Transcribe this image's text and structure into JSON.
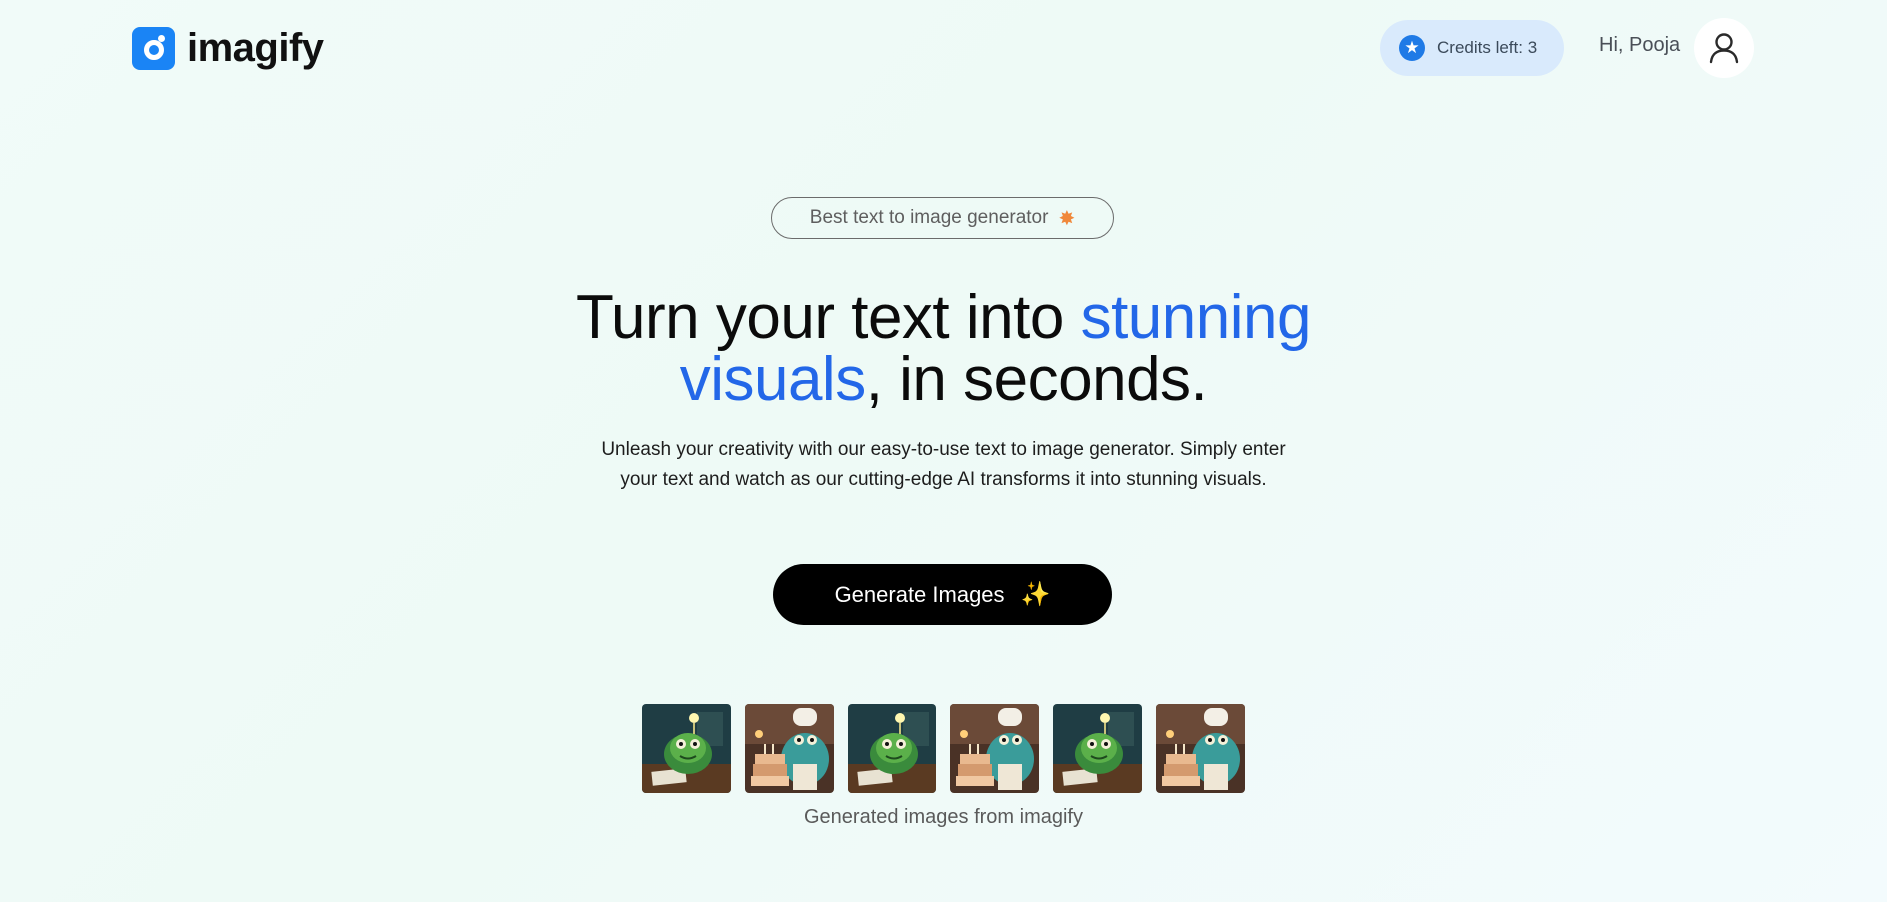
{
  "header": {
    "logo_text": "imagify",
    "credits_label": "Credits left: 3",
    "greeting": "Hi, Pooja"
  },
  "hero": {
    "badge_text": "Best text to image generator",
    "headline_part1": "Turn your text into ",
    "headline_accent1": "stunning",
    "headline_accent2": "visuals",
    "headline_part2": ", in seconds.",
    "subtext": "Unleash your creativity with our easy-to-use text to image generator. Simply enter your text and watch as our cutting-edge AI transforms it into stunning visuals.",
    "cta_label": "Generate Images",
    "cta_icon": "sparkles-icon"
  },
  "gallery": {
    "images": [
      {
        "name": "monster-lamp"
      },
      {
        "name": "monster-chef-cake"
      },
      {
        "name": "monster-lamp"
      },
      {
        "name": "monster-chef-cake"
      },
      {
        "name": "monster-lamp"
      },
      {
        "name": "monster-chef-cake"
      }
    ],
    "caption": "Generated images from imagify"
  },
  "colors": {
    "accent": "#2367e8",
    "brand": "#1a84f5",
    "credits_bg": "#d9eafc",
    "cta_bg": "#000000"
  }
}
